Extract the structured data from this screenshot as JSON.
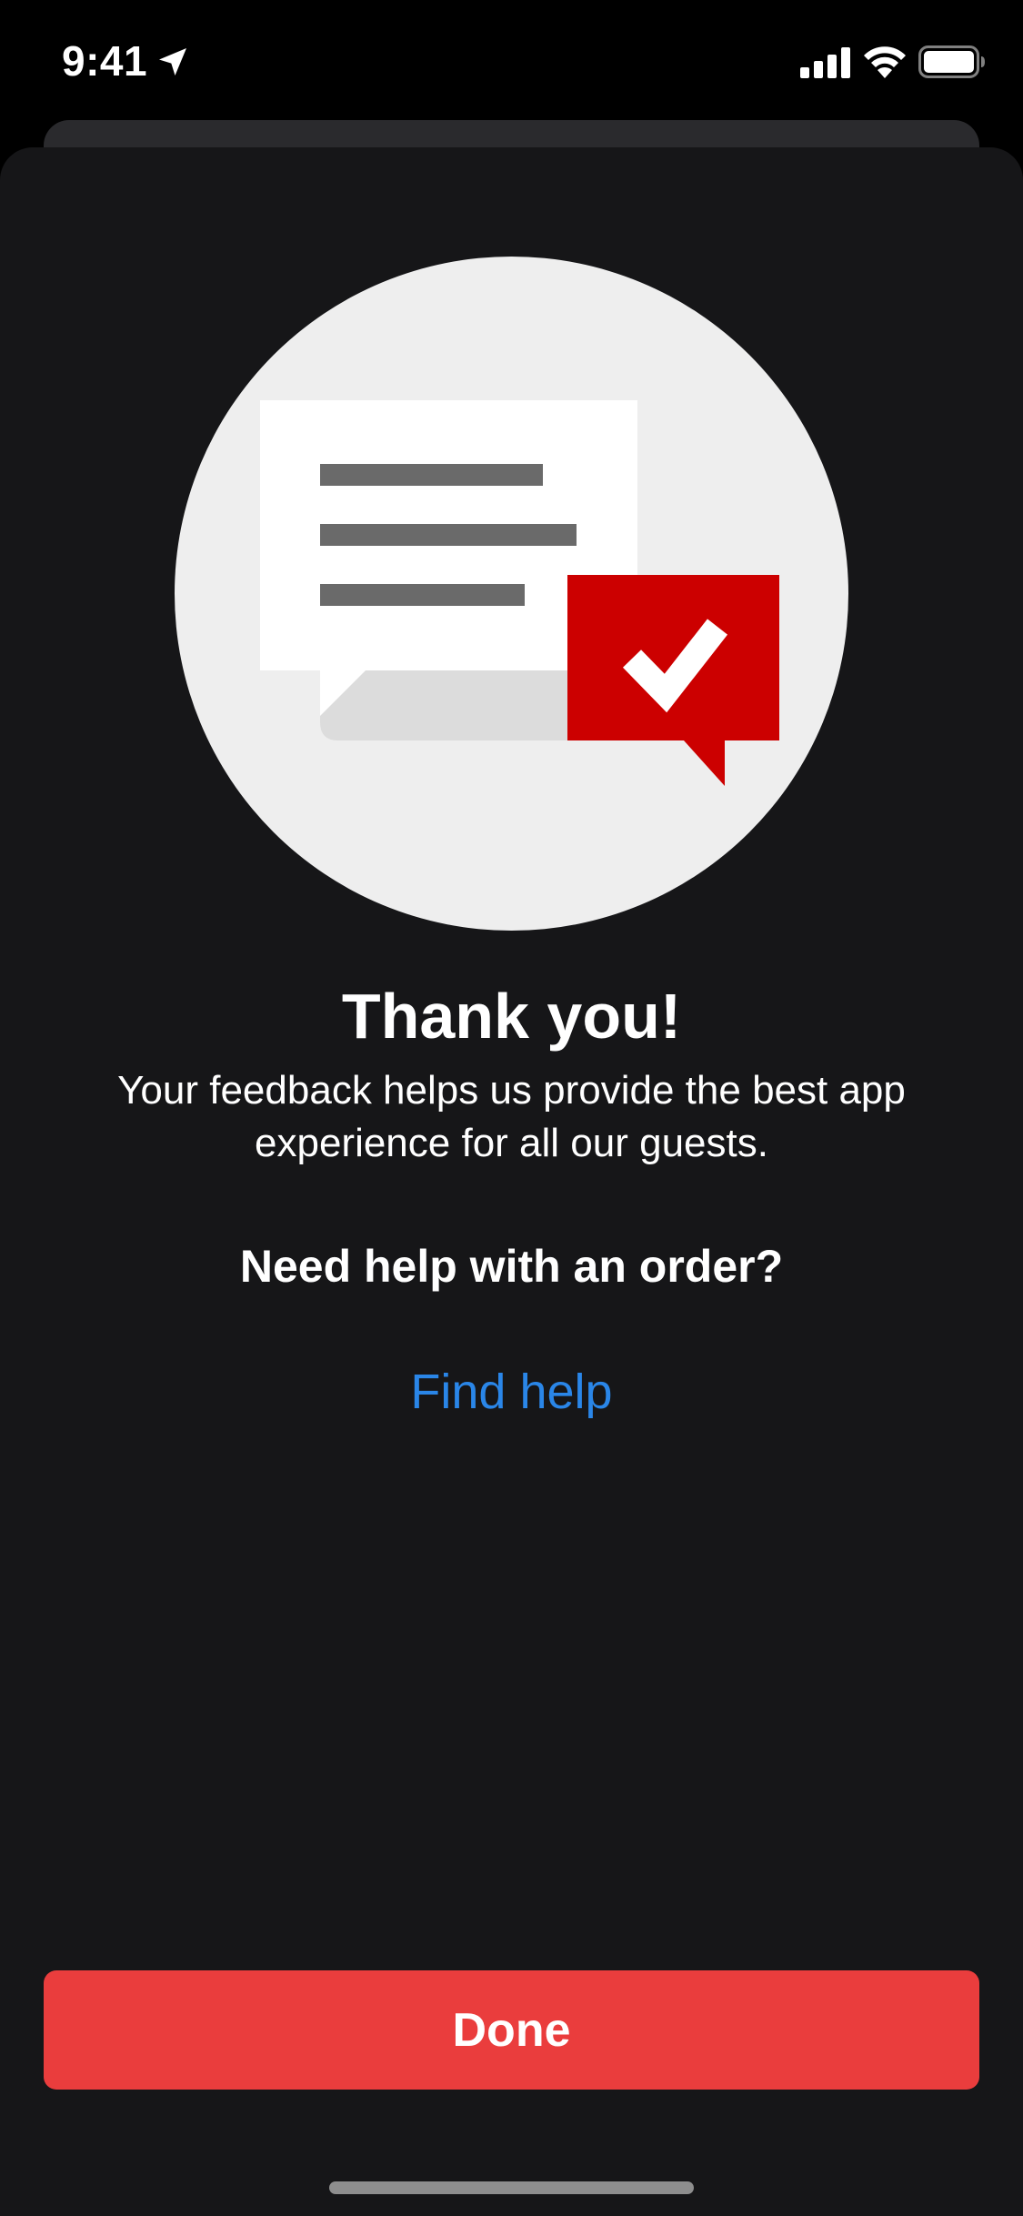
{
  "status_bar": {
    "time": "9:41",
    "icons": [
      "location-arrow-icon",
      "cellular-signal-icon",
      "wifi-icon",
      "battery-icon"
    ]
  },
  "illustration": {
    "icon": "feedback-chat-check-icon"
  },
  "content": {
    "title": "Thank you!",
    "subtitle": "Your feedback helps us provide the best app experience for all our guests.",
    "help_heading": "Need help with an order?",
    "find_help_link": "Find help"
  },
  "footer": {
    "done_label": "Done"
  },
  "colors": {
    "background": "#161618",
    "accent_red": "#ea3d3d",
    "brand_red": "#cc0000",
    "link_blue": "#2a86e8",
    "illustration_circle": "#eeeeee"
  }
}
